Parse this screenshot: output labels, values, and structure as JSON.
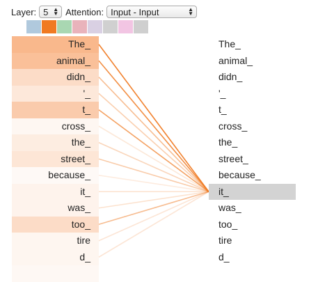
{
  "controls": {
    "layer_label": "Layer:",
    "layer_value": "5",
    "attention_label": "Attention:",
    "attention_value": "Input - Input"
  },
  "heads": {
    "colors": [
      "#b0c9dd",
      "#f07a22",
      "#a9d7b2",
      "#e9b3bb",
      "#d9d0e3",
      "#d0d0d0",
      "#f2c5e3",
      "#cfcfcf"
    ],
    "active_index": 1
  },
  "tokens_left": [
    {
      "text": "The_",
      "weight": 0.62
    },
    {
      "text": "animal_",
      "weight": 0.55
    },
    {
      "text": "didn_",
      "weight": 0.3
    },
    {
      "text": "'_",
      "weight": 0.2
    },
    {
      "text": "t_",
      "weight": 0.45
    },
    {
      "text": "cross_",
      "weight": 0.07
    },
    {
      "text": "the_",
      "weight": 0.16
    },
    {
      "text": "street_",
      "weight": 0.22
    },
    {
      "text": "because_",
      "weight": 0.05
    },
    {
      "text": "it_",
      "weight": 0.1
    },
    {
      "text": "was_",
      "weight": 0.1
    },
    {
      "text": "too_",
      "weight": 0.3
    },
    {
      "text": "tire",
      "weight": 0.08
    },
    {
      "text": "d_",
      "weight": 0.08
    },
    {
      "text": "",
      "weight": 0.06
    }
  ],
  "tokens_right": [
    "The_",
    "animal_",
    "didn_",
    "'_",
    "t_",
    "cross_",
    "the_",
    "street_",
    "because_",
    "it_",
    "was_",
    "too_",
    "tire",
    "d_"
  ],
  "selected_right_index": 9
}
